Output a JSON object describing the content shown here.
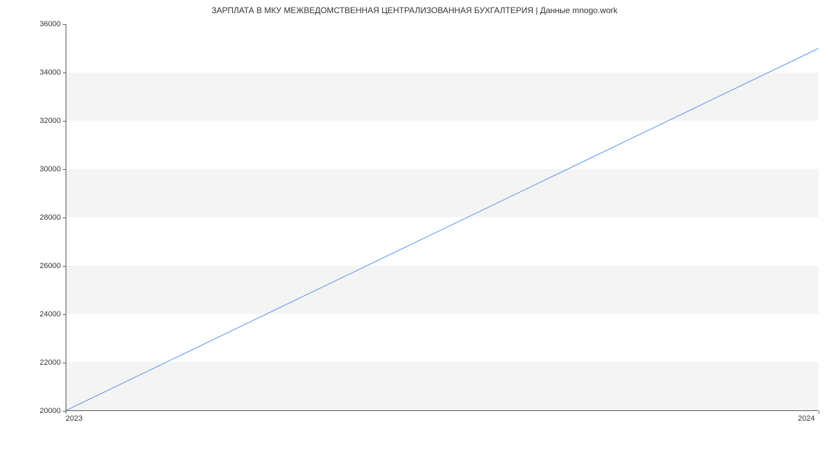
{
  "chart_data": {
    "type": "line",
    "title": "ЗАРПЛАТА В МКУ МЕЖВЕДОМСТВЕННАЯ ЦЕНТРАЛИЗОВАННАЯ БУХГАЛТЕРИЯ | Данные mnogo.work",
    "x": [
      2023,
      2024
    ],
    "values": [
      20000,
      35000
    ],
    "xlabel": "",
    "ylabel": "",
    "xlim": [
      2023,
      2024
    ],
    "ylim": [
      20000,
      36000
    ],
    "yticks": [
      20000,
      22000,
      24000,
      26000,
      28000,
      30000,
      32000,
      34000,
      36000
    ],
    "xticks": [
      2023,
      2024
    ],
    "line_color": "#6f9fe8"
  }
}
